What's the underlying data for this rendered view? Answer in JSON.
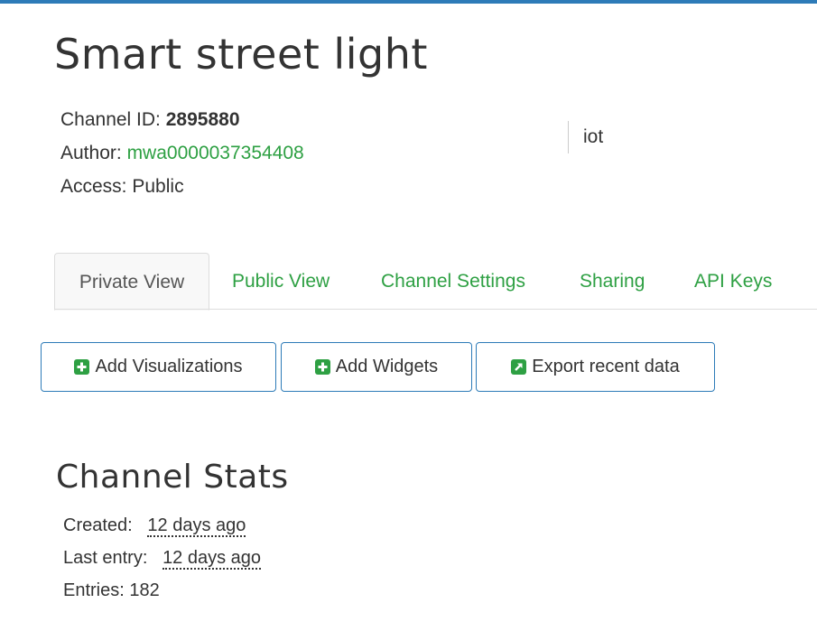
{
  "channel": {
    "title": "Smart street light",
    "id_label": "Channel ID:",
    "id_value": "2895880",
    "author_label": "Author:",
    "author_value": "mwa0000037354408",
    "access_label": "Access:",
    "access_value": "Public",
    "tag": "iot"
  },
  "tabs": [
    {
      "label": "Private View",
      "active": true
    },
    {
      "label": "Public View",
      "active": false
    },
    {
      "label": "Channel Settings",
      "active": false
    },
    {
      "label": "Sharing",
      "active": false
    },
    {
      "label": "API Keys",
      "active": false
    }
  ],
  "buttons": {
    "add_visualizations": {
      "label": "Add Visualizations",
      "icon": "plus-square-icon"
    },
    "add_widgets": {
      "label": "Add Widgets",
      "icon": "plus-square-icon"
    },
    "export_recent_data": {
      "label": "Export recent data",
      "icon": "external-link-square-icon"
    }
  },
  "stats": {
    "title": "Channel Stats",
    "created_label": "Created:",
    "created_value": "12 days ago",
    "last_entry_label": "Last entry:",
    "last_entry_value": "12 days ago",
    "entries_label": "Entries:",
    "entries_value": "182"
  },
  "colors": {
    "accent_bar": "#2d7bb8",
    "link_green": "#2ea043",
    "text": "#333333"
  }
}
